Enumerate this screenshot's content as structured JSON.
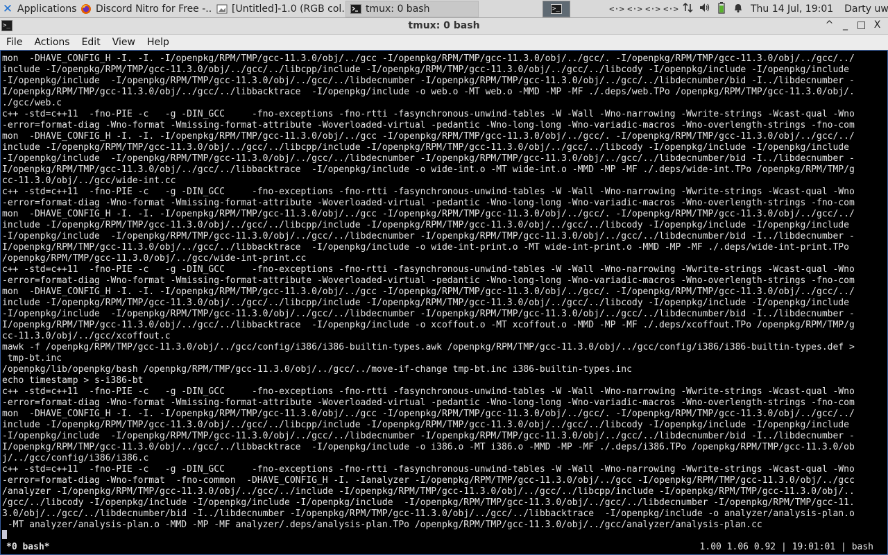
{
  "panel": {
    "apps_label": "Applications",
    "tasks": [
      {
        "title": "Discord Nitro for Free -..."
      },
      {
        "title": "[Untitled]-1.0 (RGB col..."
      },
      {
        "title": "tmux: 0 bash"
      }
    ],
    "network_icons": [
      "<·>",
      "<·>",
      "<·>",
      "<·>"
    ],
    "clock": "Thu 14 Jul, 19:01",
    "user": "Darty uwu"
  },
  "window": {
    "title": "tmux: 0 bash",
    "controls": [
      "^",
      "_",
      "□",
      "X"
    ]
  },
  "menu": [
    "File",
    "Actions",
    "Edit",
    "View",
    "Help"
  ],
  "terminal": {
    "lines": [
      "mon  -DHAVE_CONFIG_H -I. -I. -I/openpkg/RPM/TMP/gcc-11.3.0/obj/../gcc -I/openpkg/RPM/TMP/gcc-11.3.0/obj/../gcc/. -I/openpkg/RPM/TMP/gcc-11.3.0/obj/../gcc/../",
      "include -I/openpkg/RPM/TMP/gcc-11.3.0/obj/../gcc/../libcpp/include -I/openpkg/RPM/TMP/gcc-11.3.0/obj/../gcc/../libcody -I/openpkg/include -I/openpkg/include",
      "-I/openpkg/include  -I/openpkg/RPM/TMP/gcc-11.3.0/obj/../gcc/../libdecnumber -I/openpkg/RPM/TMP/gcc-11.3.0/obj/../gcc/../libdecnumber/bid -I../libdecnumber -",
      "I/openpkg/RPM/TMP/gcc-11.3.0/obj/../gcc/../libbacktrace  -I/openpkg/include -o web.o -MT web.o -MMD -MP -MF ./.deps/web.TPo /openpkg/RPM/TMP/gcc-11.3.0/obj/.",
      "./gcc/web.c",
      "c++ -std=c++11  -fno-PIE -c   -g -DIN_GCC     -fno-exceptions -fno-rtti -fasynchronous-unwind-tables -W -Wall -Wno-narrowing -Wwrite-strings -Wcast-qual -Wno",
      "-error=format-diag -Wno-format -Wmissing-format-attribute -Woverloaded-virtual -pedantic -Wno-long-long -Wno-variadic-macros -Wno-overlength-strings -fno-com",
      "mon  -DHAVE_CONFIG_H -I. -I. -I/openpkg/RPM/TMP/gcc-11.3.0/obj/../gcc -I/openpkg/RPM/TMP/gcc-11.3.0/obj/../gcc/. -I/openpkg/RPM/TMP/gcc-11.3.0/obj/../gcc/../",
      "include -I/openpkg/RPM/TMP/gcc-11.3.0/obj/../gcc/../libcpp/include -I/openpkg/RPM/TMP/gcc-11.3.0/obj/../gcc/../libcody -I/openpkg/include -I/openpkg/include",
      "-I/openpkg/include  -I/openpkg/RPM/TMP/gcc-11.3.0/obj/../gcc/../libdecnumber -I/openpkg/RPM/TMP/gcc-11.3.0/obj/../gcc/../libdecnumber/bid -I../libdecnumber -",
      "I/openpkg/RPM/TMP/gcc-11.3.0/obj/../gcc/../libbacktrace  -I/openpkg/include -o wide-int.o -MT wide-int.o -MMD -MP -MF ./.deps/wide-int.TPo /openpkg/RPM/TMP/g",
      "cc-11.3.0/obj/../gcc/wide-int.cc",
      "c++ -std=c++11  -fno-PIE -c   -g -DIN_GCC     -fno-exceptions -fno-rtti -fasynchronous-unwind-tables -W -Wall -Wno-narrowing -Wwrite-strings -Wcast-qual -Wno",
      "-error=format-diag -Wno-format -Wmissing-format-attribute -Woverloaded-virtual -pedantic -Wno-long-long -Wno-variadic-macros -Wno-overlength-strings -fno-com",
      "mon  -DHAVE_CONFIG_H -I. -I. -I/openpkg/RPM/TMP/gcc-11.3.0/obj/../gcc -I/openpkg/RPM/TMP/gcc-11.3.0/obj/../gcc/. -I/openpkg/RPM/TMP/gcc-11.3.0/obj/../gcc/../",
      "include -I/openpkg/RPM/TMP/gcc-11.3.0/obj/../gcc/../libcpp/include -I/openpkg/RPM/TMP/gcc-11.3.0/obj/../gcc/../libcody -I/openpkg/include -I/openpkg/include",
      "-I/openpkg/include  -I/openpkg/RPM/TMP/gcc-11.3.0/obj/../gcc/../libdecnumber -I/openpkg/RPM/TMP/gcc-11.3.0/obj/../gcc/../libdecnumber/bid -I../libdecnumber -",
      "I/openpkg/RPM/TMP/gcc-11.3.0/obj/../gcc/../libbacktrace  -I/openpkg/include -o wide-int-print.o -MT wide-int-print.o -MMD -MP -MF ./.deps/wide-int-print.TPo",
      "/openpkg/RPM/TMP/gcc-11.3.0/obj/../gcc/wide-int-print.cc",
      "c++ -std=c++11  -fno-PIE -c   -g -DIN_GCC     -fno-exceptions -fno-rtti -fasynchronous-unwind-tables -W -Wall -Wno-narrowing -Wwrite-strings -Wcast-qual -Wno",
      "-error=format-diag -Wno-format -Wmissing-format-attribute -Woverloaded-virtual -pedantic -Wno-long-long -Wno-variadic-macros -Wno-overlength-strings -fno-com",
      "mon  -DHAVE_CONFIG_H -I. -I. -I/openpkg/RPM/TMP/gcc-11.3.0/obj/../gcc -I/openpkg/RPM/TMP/gcc-11.3.0/obj/../gcc/. -I/openpkg/RPM/TMP/gcc-11.3.0/obj/../gcc/../",
      "include -I/openpkg/RPM/TMP/gcc-11.3.0/obj/../gcc/../libcpp/include -I/openpkg/RPM/TMP/gcc-11.3.0/obj/../gcc/../libcody -I/openpkg/include -I/openpkg/include",
      "-I/openpkg/include  -I/openpkg/RPM/TMP/gcc-11.3.0/obj/../gcc/../libdecnumber -I/openpkg/RPM/TMP/gcc-11.3.0/obj/../gcc/../libdecnumber/bid -I../libdecnumber -",
      "I/openpkg/RPM/TMP/gcc-11.3.0/obj/../gcc/../libbacktrace  -I/openpkg/include -o xcoffout.o -MT xcoffout.o -MMD -MP -MF ./.deps/xcoffout.TPo /openpkg/RPM/TMP/g",
      "cc-11.3.0/obj/../gcc/xcoffout.c",
      "mawk -f /openpkg/RPM/TMP/gcc-11.3.0/obj/../gcc/config/i386/i386-builtin-types.awk /openpkg/RPM/TMP/gcc-11.3.0/obj/../gcc/config/i386/i386-builtin-types.def >",
      " tmp-bt.inc",
      "/openpkg/lib/openpkg/bash /openpkg/RPM/TMP/gcc-11.3.0/obj/../gcc/../move-if-change tmp-bt.inc i386-builtin-types.inc",
      "echo timestamp > s-i386-bt",
      "c++ -std=c++11  -fno-PIE -c   -g -DIN_GCC     -fno-exceptions -fno-rtti -fasynchronous-unwind-tables -W -Wall -Wno-narrowing -Wwrite-strings -Wcast-qual -Wno",
      "-error=format-diag -Wno-format -Wmissing-format-attribute -Woverloaded-virtual -pedantic -Wno-long-long -Wno-variadic-macros -Wno-overlength-strings -fno-com",
      "mon  -DHAVE_CONFIG_H -I. -I. -I/openpkg/RPM/TMP/gcc-11.3.0/obj/../gcc -I/openpkg/RPM/TMP/gcc-11.3.0/obj/../gcc/. -I/openpkg/RPM/TMP/gcc-11.3.0/obj/../gcc/../",
      "include -I/openpkg/RPM/TMP/gcc-11.3.0/obj/../gcc/../libcpp/include -I/openpkg/RPM/TMP/gcc-11.3.0/obj/../gcc/../libcody -I/openpkg/include -I/openpkg/include",
      "-I/openpkg/include  -I/openpkg/RPM/TMP/gcc-11.3.0/obj/../gcc/../libdecnumber -I/openpkg/RPM/TMP/gcc-11.3.0/obj/../gcc/../libdecnumber/bid -I../libdecnumber -",
      "I/openpkg/RPM/TMP/gcc-11.3.0/obj/../gcc/../libbacktrace  -I/openpkg/include -o i386.o -MT i386.o -MMD -MP -MF ./.deps/i386.TPo /openpkg/RPM/TMP/gcc-11.3.0/ob",
      "j/../gcc/config/i386/i386.c",
      "c++ -std=c++11  -fno-PIE -c   -g -DIN_GCC     -fno-exceptions -fno-rtti -fasynchronous-unwind-tables -W -Wall -Wno-narrowing -Wwrite-strings -Wcast-qual -Wno",
      "-error=format-diag -Wno-format  -fno-common  -DHAVE_CONFIG_H -I. -Ianalyzer -I/openpkg/RPM/TMP/gcc-11.3.0/obj/../gcc -I/openpkg/RPM/TMP/gcc-11.3.0/obj/../gcc",
      "/analyzer -I/openpkg/RPM/TMP/gcc-11.3.0/obj/../gcc/../include -I/openpkg/RPM/TMP/gcc-11.3.0/obj/../gcc/../libcpp/include -I/openpkg/RPM/TMP/gcc-11.3.0/obj/..",
      "/gcc/../libcody -I/openpkg/include -I/openpkg/include -I/openpkg/include  -I/openpkg/RPM/TMP/gcc-11.3.0/obj/../gcc/../libdecnumber -I/openpkg/RPM/TMP/gcc-11.",
      "3.0/obj/../gcc/../libdecnumber/bid -I../libdecnumber -I/openpkg/RPM/TMP/gcc-11.3.0/obj/../gcc/../libbacktrace  -I/openpkg/include -o analyzer/analysis-plan.o",
      " -MT analyzer/analysis-plan.o -MMD -MP -MF analyzer/.deps/analysis-plan.TPo /openpkg/RPM/TMP/gcc-11.3.0/obj/../gcc/analyzer/analysis-plan.cc"
    ]
  },
  "tmux": {
    "window_label": "*0 bash*",
    "right_status": "1.00 1.06 0.92 | 19:01:01 | bash"
  },
  "colors": {
    "panel_bg": "#d9d9d9",
    "terminal_bg": "#000000",
    "terminal_fg": "#e5e5e5",
    "accent": "#1e6fd0"
  }
}
